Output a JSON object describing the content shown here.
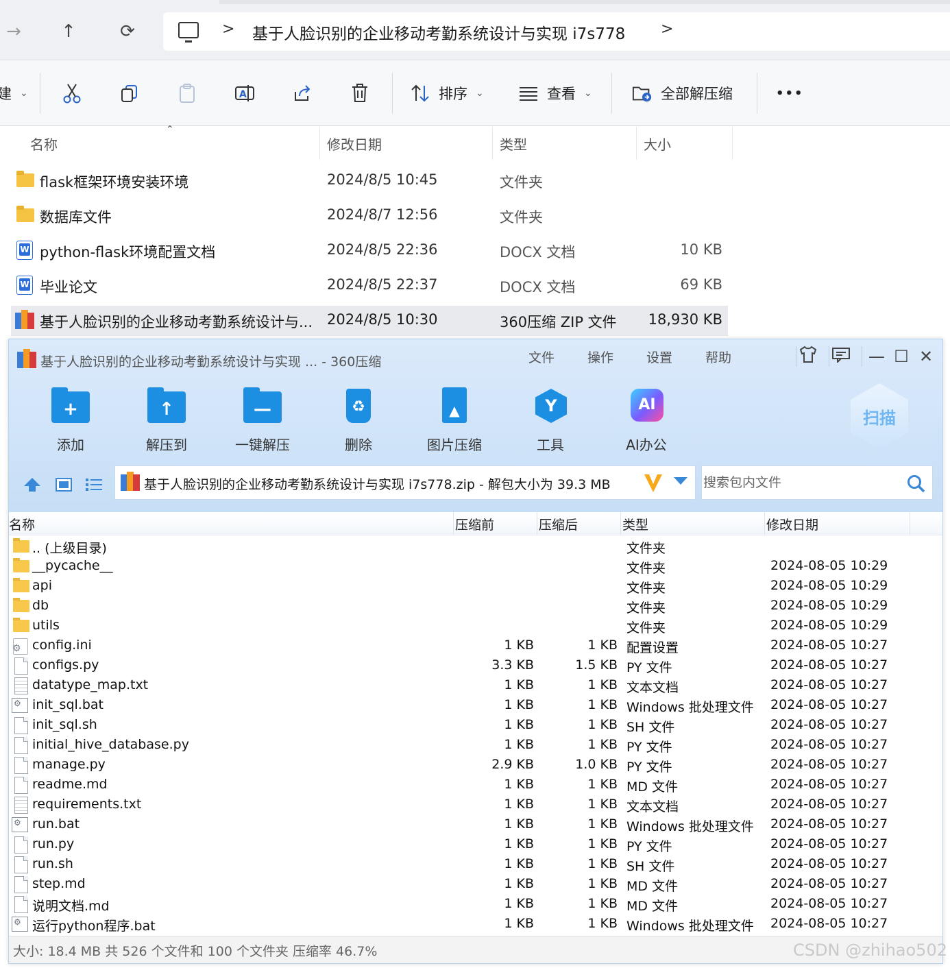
{
  "explorer": {
    "breadcrumb": {
      "separator": ">",
      "folder": "基于人脸识别的企业移动考勤系统设计与实现 i7s778",
      "trail": ">"
    },
    "nav": {
      "forward": "→",
      "up": "↑",
      "refresh": "⟳"
    },
    "toolbar": {
      "new_fragment": "建",
      "sort_label": "排序",
      "view_label": "查看",
      "extract_all_label": "全部解压缩",
      "more": "•••"
    },
    "columns": {
      "name": "名称",
      "date": "修改日期",
      "type": "类型",
      "size": "大小"
    },
    "rows": [
      {
        "name": "flask框架环境安装环境",
        "date": "2024/8/5 10:45",
        "type": "文件夹",
        "size": "",
        "icon": "folder-icon"
      },
      {
        "name": "数据库文件",
        "date": "2024/8/7 12:56",
        "type": "文件夹",
        "size": "",
        "icon": "folder-icon"
      },
      {
        "name": "python-flask环境配置文档",
        "date": "2024/8/5 22:36",
        "type": "DOCX 文档",
        "size": "10 KB",
        "icon": "docx-icon"
      },
      {
        "name": "毕业论文",
        "date": "2024/8/5 22:37",
        "type": "DOCX 文档",
        "size": "69 KB",
        "icon": "docx-icon"
      },
      {
        "name": "基于人脸识别的企业移动考勤系统设计与...",
        "date": "2024/8/5 10:30",
        "type": "360压缩 ZIP 文件",
        "size": "18,930 KB",
        "icon": "zip-icon"
      }
    ]
  },
  "archiver": {
    "title": "基于人脸识别的企业移动考勤系统设计与实现 ... - 360压缩",
    "menu": [
      "文件",
      "操作",
      "设置",
      "帮助"
    ],
    "big_buttons": [
      {
        "label": "添加",
        "glyph": "+"
      },
      {
        "label": "解压到",
        "glyph": "↑"
      },
      {
        "label": "一键解压",
        "glyph": "—"
      },
      {
        "label": "删除",
        "glyph": "♻"
      },
      {
        "label": "图片压缩",
        "glyph": "▲"
      },
      {
        "label": "工具",
        "glyph": "Y"
      },
      {
        "label": "AI办公",
        "glyph": "AI"
      }
    ],
    "scan_label": "扫描",
    "path": "基于人脸识别的企业移动考勤系统设计与实现 i7s778.zip - 解包大小为 39.3 MB",
    "search_placeholder": "搜索包内文件",
    "columns": {
      "name": "名称",
      "before": "压缩前",
      "after": "压缩后",
      "type": "类型",
      "date": "修改日期"
    },
    "files": [
      {
        "name": ".. (上级目录)",
        "before": "",
        "after": "",
        "type": "文件夹",
        "date": "",
        "icon": "folder"
      },
      {
        "name": "__pycache__",
        "before": "",
        "after": "",
        "type": "文件夹",
        "date": "2024-08-05 10:29",
        "icon": "folder"
      },
      {
        "name": "api",
        "before": "",
        "after": "",
        "type": "文件夹",
        "date": "2024-08-05 10:29",
        "icon": "folder"
      },
      {
        "name": "db",
        "before": "",
        "after": "",
        "type": "文件夹",
        "date": "2024-08-05 10:29",
        "icon": "folder"
      },
      {
        "name": "utils",
        "before": "",
        "after": "",
        "type": "文件夹",
        "date": "2024-08-05 10:29",
        "icon": "folder"
      },
      {
        "name": "config.ini",
        "before": "1 KB",
        "after": "1 KB",
        "type": "配置设置",
        "date": "2024-08-05 10:27",
        "icon": "ini"
      },
      {
        "name": "configs.py",
        "before": "3.3 KB",
        "after": "1.5 KB",
        "type": "PY 文件",
        "date": "2024-08-05 10:27",
        "icon": "file"
      },
      {
        "name": "datatype_map.txt",
        "before": "1 KB",
        "after": "1 KB",
        "type": "文本文档",
        "date": "2024-08-05 10:27",
        "icon": "txt"
      },
      {
        "name": "init_sql.bat",
        "before": "1 KB",
        "after": "1 KB",
        "type": "Windows 批处理文件",
        "date": "2024-08-05 10:27",
        "icon": "bat"
      },
      {
        "name": "init_sql.sh",
        "before": "1 KB",
        "after": "1 KB",
        "type": "SH 文件",
        "date": "2024-08-05 10:27",
        "icon": "file"
      },
      {
        "name": "initial_hive_database.py",
        "before": "1 KB",
        "after": "1 KB",
        "type": "PY 文件",
        "date": "2024-08-05 10:27",
        "icon": "file"
      },
      {
        "name": "manage.py",
        "before": "2.9 KB",
        "after": "1.0 KB",
        "type": "PY 文件",
        "date": "2024-08-05 10:27",
        "icon": "file"
      },
      {
        "name": "readme.md",
        "before": "1 KB",
        "after": "1 KB",
        "type": "MD 文件",
        "date": "2024-08-05 10:27",
        "icon": "file"
      },
      {
        "name": "requirements.txt",
        "before": "1 KB",
        "after": "1 KB",
        "type": "文本文档",
        "date": "2024-08-05 10:27",
        "icon": "txt"
      },
      {
        "name": "run.bat",
        "before": "1 KB",
        "after": "1 KB",
        "type": "Windows 批处理文件",
        "date": "2024-08-05 10:27",
        "icon": "bat"
      },
      {
        "name": "run.py",
        "before": "1 KB",
        "after": "1 KB",
        "type": "PY 文件",
        "date": "2024-08-05 10:27",
        "icon": "file"
      },
      {
        "name": "run.sh",
        "before": "1 KB",
        "after": "1 KB",
        "type": "SH 文件",
        "date": "2024-08-05 10:27",
        "icon": "file"
      },
      {
        "name": "step.md",
        "before": "1 KB",
        "after": "1 KB",
        "type": "MD 文件",
        "date": "2024-08-05 10:27",
        "icon": "file"
      },
      {
        "name": "说明文档.md",
        "before": "1 KB",
        "after": "1 KB",
        "type": "MD 文件",
        "date": "2024-08-05 10:27",
        "icon": "file"
      },
      {
        "name": "运行python程序.bat",
        "before": "1 KB",
        "after": "1 KB",
        "type": "Windows 批处理文件",
        "date": "2024-08-05 10:27",
        "icon": "bat"
      }
    ],
    "status": "大小: 18.4 MB 共 526 个文件和 100 个文件夹 压缩率 46.7%"
  },
  "watermark": "CSDN @zhihao502",
  "colors": {
    "accent_blue": "#1d8fe3",
    "window_bg": "#cfe3f8",
    "selected_row": "#e9eaed"
  }
}
